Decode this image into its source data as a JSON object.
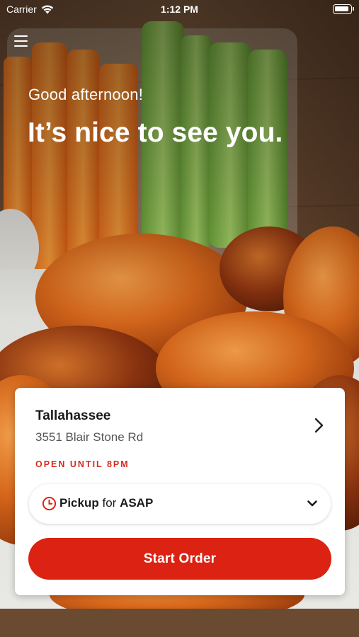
{
  "status_bar": {
    "carrier": "Carrier",
    "time": "1:12 PM"
  },
  "header": {
    "menu_icon": "hamburger-menu-icon"
  },
  "greeting": {
    "salutation": "Good afternoon!",
    "headline": "It’s nice to see you."
  },
  "store": {
    "name": "Tallahassee",
    "address": "3551 Blair Stone Rd",
    "hours": "OPEN UNTIL 8PM"
  },
  "order_mode": {
    "mode": "Pickup",
    "connector": "for",
    "time": "ASAP"
  },
  "actions": {
    "start_order": "Start Order"
  },
  "colors": {
    "accent_red": "#dc2212",
    "hours_red": "#d62a1e"
  }
}
